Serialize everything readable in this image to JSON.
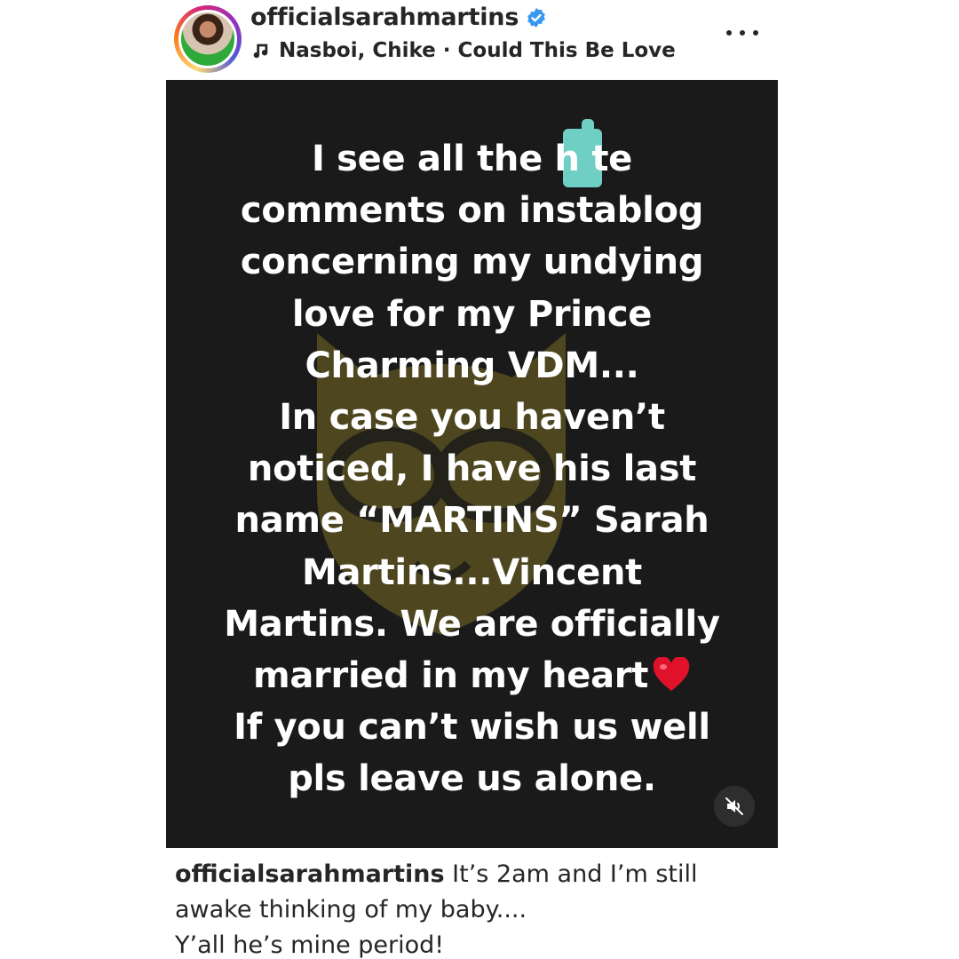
{
  "post": {
    "username": "officialsarahmartins",
    "music": "Nasboi, Chike · Could This Be Love",
    "icons": {
      "avatar": "profile-avatar",
      "verified": "verified-badge-icon",
      "music": "music-note-icon",
      "more": "more-options-icon",
      "mute": "sound-off-icon",
      "heart": "red-heart-emoji"
    },
    "colors": {
      "verified": "#3897f0",
      "story_bg": "#1a1a1a",
      "heart": "#e0122b",
      "redaction": "#6fcfc4"
    }
  },
  "story": {
    "watermark": "instablog9ja",
    "lines": [
      "I see all the h   te",
      "comments on instablog",
      "concerning my undying",
      "love for my Prince",
      "Charming VDM...",
      "In case you haven’t",
      "noticed, I have his last",
      "name “MARTINS” Sarah",
      "Martins...Vincent",
      "Martins. We are officially",
      "married in my heart",
      "If you can’t wish us well",
      "pls leave us alone."
    ]
  },
  "caption": {
    "username": "officialsarahmartins",
    "line1": " It’s 2am and I’m still",
    "line2": "awake thinking of my baby....",
    "line3": "Y’all he’s mine period!"
  }
}
